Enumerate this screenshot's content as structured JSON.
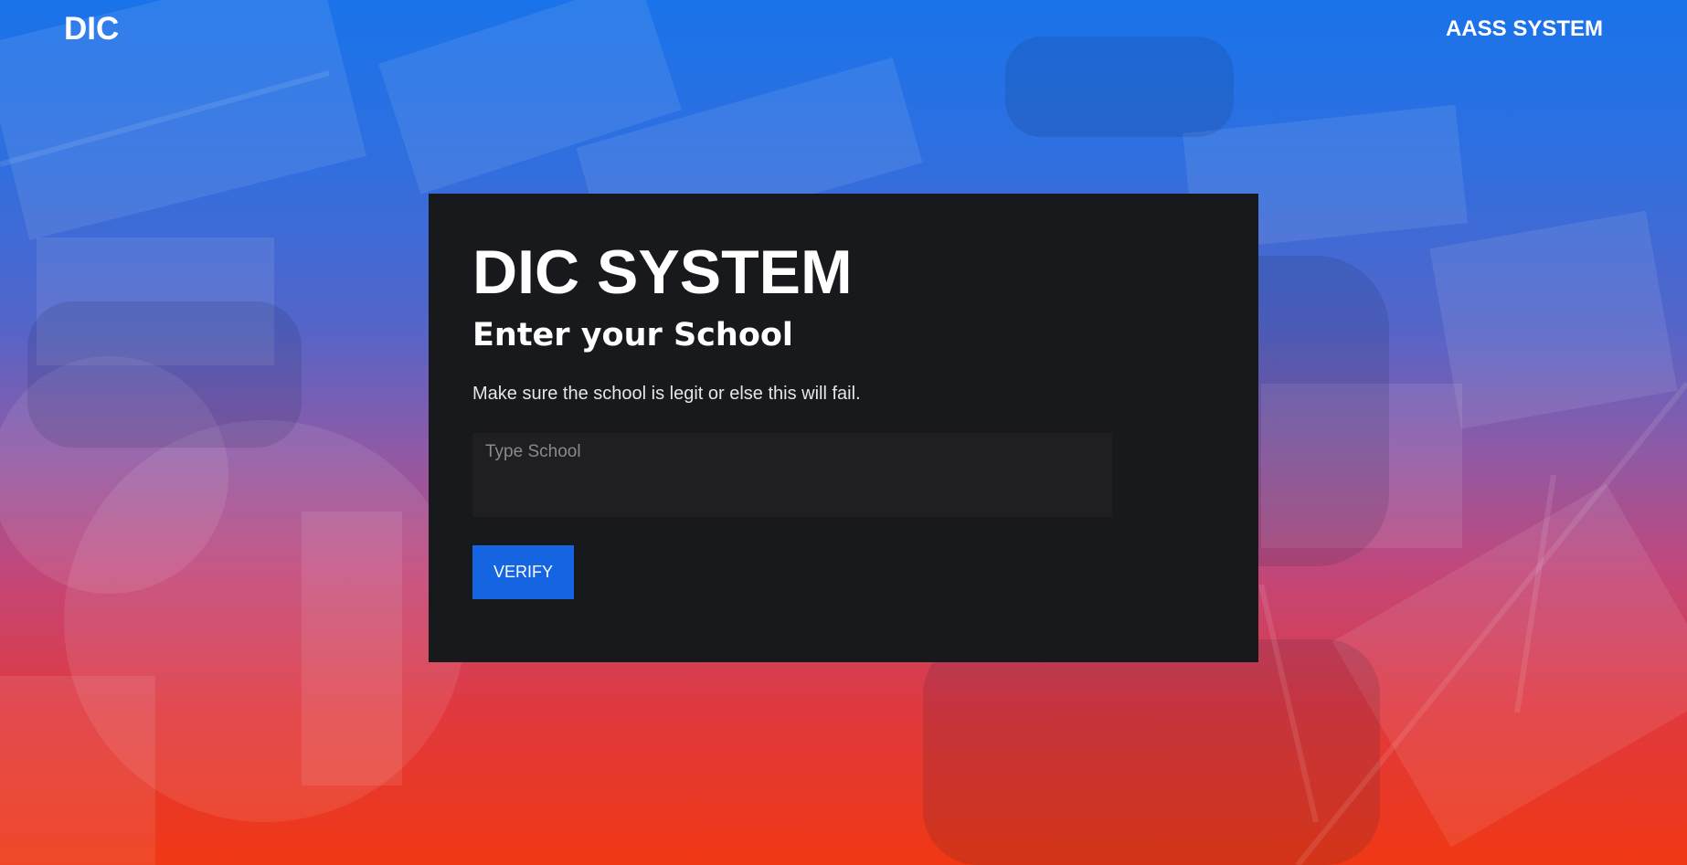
{
  "header": {
    "brand": "DIC",
    "nav_link": "AASS SYSTEM"
  },
  "card": {
    "title": "DIC SYSTEM",
    "subtitle": "Enter your School",
    "description": "Make sure the school is legit or else this will fail.",
    "school_input": {
      "value": "",
      "placeholder": "Type School"
    },
    "verify_label": "VERIFY"
  },
  "colors": {
    "gradient_top": "#1a73ea",
    "gradient_bottom": "#f03813",
    "card_background": "#18191d",
    "input_background": "#1f1f22",
    "button": "#1565e3"
  }
}
